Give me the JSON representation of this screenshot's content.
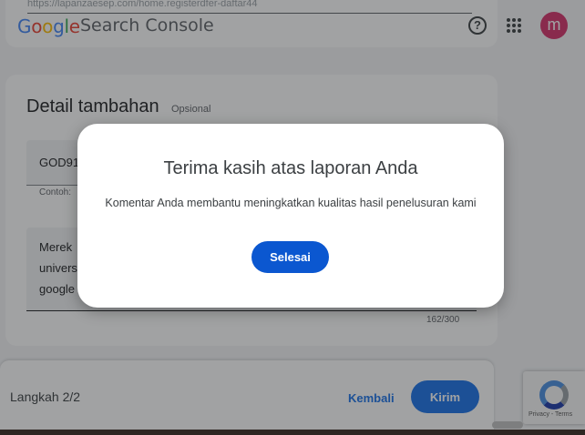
{
  "header": {
    "url_text": "https://lapanzaesep.com/home.registerdfer-daftar44",
    "logo_letters": [
      "G",
      "o",
      "o",
      "g",
      "l",
      "e"
    ],
    "product_name": "Search Console",
    "help_glyph": "?",
    "avatar_letter": "m"
  },
  "details": {
    "title": "Detail tambahan",
    "optional_label": "Opsional",
    "field1_value": "GOD91",
    "example_label": "Contoh:",
    "field2_lines": [
      "Merek",
      "univers",
      "google"
    ],
    "counter": "162/300"
  },
  "bottom": {
    "step_label": "Langkah 2/2",
    "back_label": "Kembali",
    "send_label": "Kirim"
  },
  "recaptcha": {
    "links": "Privacy - Terms"
  },
  "dialog": {
    "title": "Terima kasih atas laporan Anda",
    "message": "Komentar Anda membantu meningkatkan kualitas hasil penelusuran kami",
    "done_label": "Selesai"
  },
  "colors": {
    "accent": "#1a73e8",
    "dialog_button": "#0b57d0",
    "avatar": "#d6336c"
  }
}
